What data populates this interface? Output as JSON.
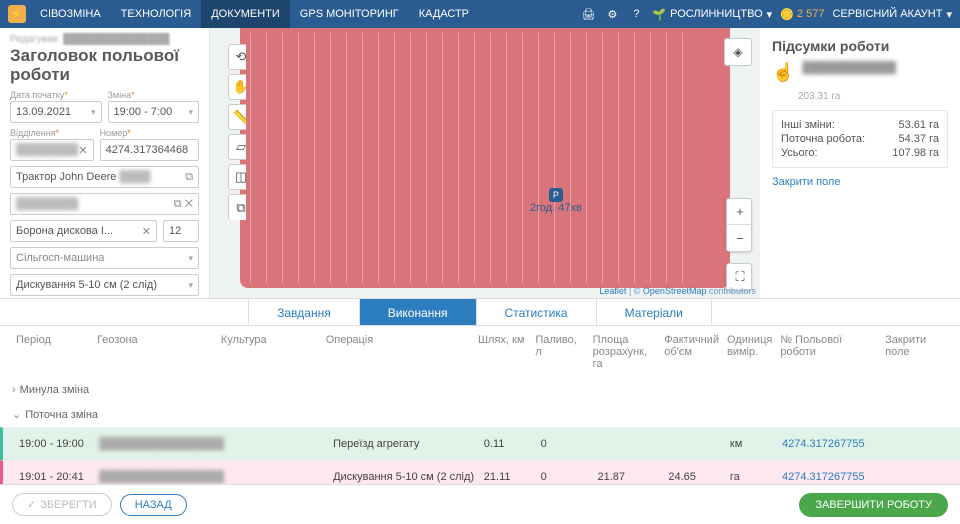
{
  "topbar": {
    "nav": [
      "СІВОЗМІНА",
      "ТЕХНОЛОГІЯ",
      "ДОКУМЕНТИ",
      "GPS МОНІТОРИНГ",
      "КАДАСТР"
    ],
    "active": 2,
    "plant": "РОСЛИННИЦТВО",
    "coins": "2 577",
    "account": "СЕРВІСНИЙ АКАУНТ"
  },
  "left": {
    "editing_label": "Редагував:",
    "title": "Заголовок польової роботи",
    "date_label": "Дата початку",
    "date_value": "13.09.2021",
    "shift_label": "Зміна",
    "shift_value": "19:00 - 7:00",
    "dept_label": "Відділення",
    "num_label": "Номер",
    "num_value": "4274.317364468",
    "tractor": "Трактор John Deere",
    "implement": "Борона дискова І...",
    "count": "12",
    "machine_placeholder": "Сільгосп-машина",
    "operation": "Дискування 5-10 см (2 слід)"
  },
  "map": {
    "marker_time": "2год. 47хв",
    "attribution_leaflet": "Leaflet",
    "attribution_osm": "OpenStreetMap",
    "attribution_tail": " contributors"
  },
  "summary": {
    "title": "Підсумки роботи",
    "area": "203.31 га",
    "other_label": "Інші зміни:",
    "other_val": "53.61 га",
    "current_label": "Поточна робота:",
    "current_val": "54.37 га",
    "total_label": "Усього:",
    "total_val": "107.98 га",
    "close_link": "Закрити поле"
  },
  "tabs": [
    "Завдання",
    "Виконання",
    "Статистика",
    "Матеріали"
  ],
  "tabs_active": 1,
  "thead": {
    "period": "Період",
    "geo": "Геозона",
    "cult": "Культура",
    "op": "Операція",
    "path": "Шлях, км",
    "fuel": "Паливо, л",
    "area": "Площа розрахунк, га",
    "fact": "Фактичний об'єм",
    "unit": "Одиниця вимір.",
    "num": "№ Польової роботи",
    "close": "Закрити поле"
  },
  "groups": {
    "prev": "Минула зміна",
    "curr": "Поточна зміна"
  },
  "rows": [
    {
      "period": "19:00 - 19:00",
      "op": "Переїзд агрегату",
      "path": "0.11",
      "fuel": "0",
      "area": "",
      "fact": "",
      "unit": "км",
      "num": "4274.317267755"
    },
    {
      "period": "19:01 - 20:41",
      "op": "Дискування 5-10 см (2 слід)",
      "path": "21.11",
      "fuel": "0",
      "area": "21.87",
      "fact": "24.65",
      "unit": "га",
      "num": "4274.317267755"
    }
  ],
  "bottom": {
    "save": "ЗБЕРЕГТИ",
    "back": "НАЗАД",
    "finish": "ЗАВЕРШИТИ РОБОТУ"
  }
}
